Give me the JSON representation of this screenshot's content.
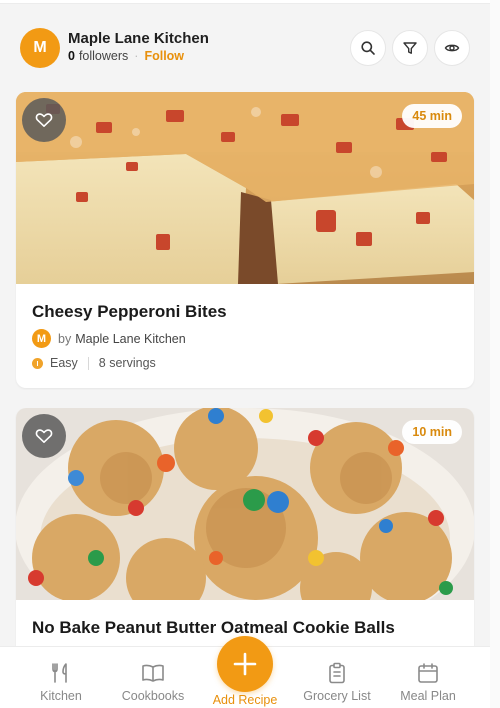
{
  "header": {
    "avatar_initial": "M",
    "kitchen_name": "Maple Lane Kitchen",
    "followers_count": "0",
    "followers_label": "followers",
    "follow_label": "Follow",
    "actions": [
      "search-icon",
      "filter-icon",
      "eye-icon"
    ]
  },
  "recipes": [
    {
      "title": "Cheesy Pepperoni Bites",
      "time": "45 min",
      "author_initial": "M",
      "by_label": "by",
      "author": "Maple Lane Kitchen",
      "difficulty": "Easy",
      "servings": "8 servings"
    },
    {
      "title": "No Bake Peanut Butter Oatmeal Cookie Balls",
      "time": "10 min"
    }
  ],
  "nav": {
    "items": [
      "Kitchen",
      "Cookbooks",
      "Add Recipe",
      "Grocery List",
      "Meal Plan"
    ],
    "active": "Add Recipe"
  },
  "colors": {
    "accent": "#f29a14",
    "accent_text": "#e8900c",
    "background": "#f4f4f4"
  }
}
